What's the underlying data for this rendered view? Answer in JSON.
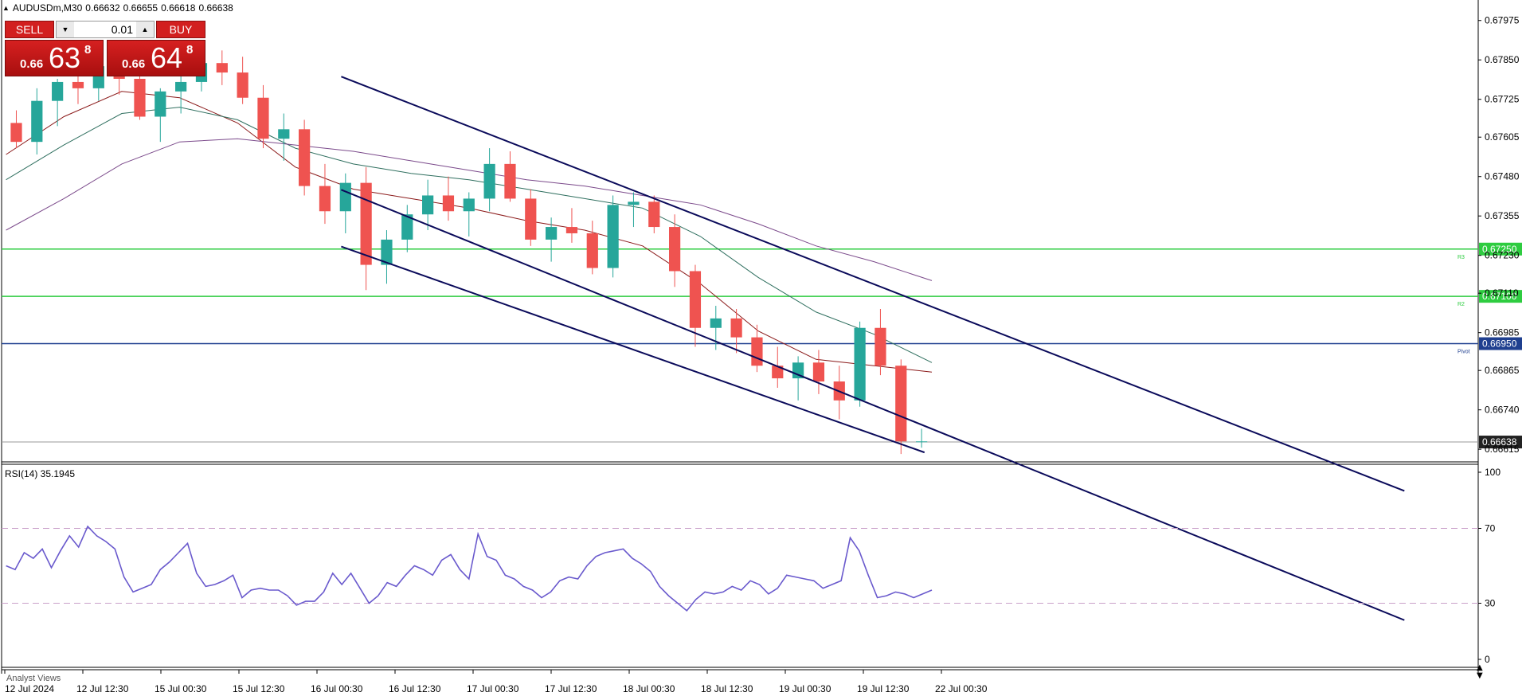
{
  "symbol_bar": {
    "symbol": "AUDUSDm,M30",
    "open": "0.66632",
    "high": "0.66655",
    "low": "0.66618",
    "close": "0.66638"
  },
  "trade_panel": {
    "sell_label": "SELL",
    "buy_label": "BUY",
    "lot": "0.01",
    "bid_prefix": "0.66",
    "bid_big": "63",
    "bid_sup": "8",
    "ask_prefix": "0.66",
    "ask_big": "64",
    "ask_sup": "8"
  },
  "colors": {
    "bull": "#26a69a",
    "bear": "#ef5350",
    "channel": "#0a0a5a",
    "level": "#2ecc40",
    "pivot": "#1f3f8f",
    "rsi": "#6a5acd",
    "ma_fast": "#8b1a1a",
    "ma_slow": "#2f6f5f",
    "ma_long": "#7b4a8b"
  },
  "analyst_views": "Analyst Views",
  "chart_data": [
    {
      "type": "candlestick",
      "title": "",
      "price_axis": {
        "ylim": [
          0.66575,
          0.6804
        ],
        "ticks": [
          "0.67975",
          "0.67850",
          "0.67725",
          "0.67605",
          "0.67480",
          "0.67355",
          "0.67230",
          "0.67110",
          "0.66985",
          "0.66865",
          "0.66740",
          "0.66615"
        ]
      },
      "time_axis": {
        "labels": [
          "12 Jul 2024",
          "12 Jul 12:30",
          "15 Jul 00:30",
          "15 Jul 12:30",
          "16 Jul 00:30",
          "16 Jul 12:30",
          "17 Jul 00:30",
          "17 Jul 12:30",
          "18 Jul 00:30",
          "18 Jul 12:30",
          "19 Jul 00:30",
          "19 Jul 12:30",
          "22 Jul 00:30"
        ]
      },
      "horizontal_levels": [
        {
          "name": "R3",
          "price": 0.6725,
          "label": "0.67250"
        },
        {
          "name": "R2",
          "price": 0.671,
          "label": "0.67100"
        },
        {
          "name": "Pivot",
          "price": 0.6695,
          "label": "0.66950"
        }
      ],
      "current_price": {
        "price": 0.66638,
        "label": "0.66638"
      },
      "channel_lines": [
        {
          "points": [
            [
              0.23,
              0.67797
            ],
            [
              0.95,
              0.66483
            ]
          ]
        },
        {
          "points": [
            [
              0.23,
              0.67438
            ],
            [
              0.95,
              0.66073
            ]
          ]
        },
        {
          "points": [
            [
              0.23,
              0.67258
            ],
            [
              0.625,
              0.66605
            ]
          ]
        }
      ],
      "ohlc": [
        [
          0.6765,
          0.6769,
          0.6757,
          0.6759
        ],
        [
          0.6759,
          0.6776,
          0.6755,
          0.6772
        ],
        [
          0.6772,
          0.6779,
          0.6764,
          0.6778
        ],
        [
          0.6778,
          0.6784,
          0.6771,
          0.6776
        ],
        [
          0.6776,
          0.6787,
          0.6772,
          0.6783
        ],
        [
          0.6783,
          0.6787,
          0.6774,
          0.6779
        ],
        [
          0.6779,
          0.6782,
          0.6766,
          0.6767
        ],
        [
          0.6767,
          0.6776,
          0.6759,
          0.6775
        ],
        [
          0.6775,
          0.6782,
          0.6768,
          0.6778
        ],
        [
          0.6778,
          0.6787,
          0.6775,
          0.6784
        ],
        [
          0.6784,
          0.6788,
          0.6777,
          0.6781
        ],
        [
          0.6781,
          0.6786,
          0.6771,
          0.6773
        ],
        [
          0.6773,
          0.6777,
          0.6757,
          0.676
        ],
        [
          0.676,
          0.6768,
          0.6753,
          0.6763
        ],
        [
          0.6763,
          0.6766,
          0.6742,
          0.6745
        ],
        [
          0.6745,
          0.6752,
          0.6733,
          0.6737
        ],
        [
          0.6737,
          0.6749,
          0.673,
          0.6746
        ],
        [
          0.6746,
          0.6751,
          0.6712,
          0.672
        ],
        [
          0.672,
          0.6731,
          0.6714,
          0.6728
        ],
        [
          0.6728,
          0.6739,
          0.6724,
          0.6736
        ],
        [
          0.6736,
          0.6747,
          0.6731,
          0.6742
        ],
        [
          0.6742,
          0.6748,
          0.6734,
          0.6737
        ],
        [
          0.6737,
          0.6743,
          0.6729,
          0.6741
        ],
        [
          0.6741,
          0.6757,
          0.6737,
          0.6752
        ],
        [
          0.6752,
          0.6756,
          0.674,
          0.6741
        ],
        [
          0.6741,
          0.6744,
          0.6726,
          0.6728
        ],
        [
          0.6728,
          0.6735,
          0.6721,
          0.6732
        ],
        [
          0.6732,
          0.6738,
          0.6727,
          0.673
        ],
        [
          0.673,
          0.6734,
          0.6717,
          0.6719
        ],
        [
          0.6719,
          0.6742,
          0.6716,
          0.6739
        ],
        [
          0.6739,
          0.6743,
          0.6732,
          0.674
        ],
        [
          0.674,
          0.6742,
          0.673,
          0.6732
        ],
        [
          0.6732,
          0.6736,
          0.6713,
          0.6718
        ],
        [
          0.6718,
          0.672,
          0.6694,
          0.67
        ],
        [
          0.67,
          0.6707,
          0.6693,
          0.6703
        ],
        [
          0.6703,
          0.6706,
          0.6692,
          0.6697
        ],
        [
          0.6697,
          0.6701,
          0.6686,
          0.6688
        ],
        [
          0.6688,
          0.6694,
          0.6681,
          0.6684
        ],
        [
          0.6684,
          0.6691,
          0.6677,
          0.6689
        ],
        [
          0.6689,
          0.6693,
          0.6679,
          0.6683
        ],
        [
          0.6683,
          0.6688,
          0.6671,
          0.6677
        ],
        [
          0.6677,
          0.6702,
          0.6675,
          0.67
        ],
        [
          0.67,
          0.6706,
          0.6685,
          0.6688
        ],
        [
          0.6688,
          0.669,
          0.666,
          0.6664
        ],
        [
          0.6664,
          0.6668,
          0.6662,
          0.6664
        ]
      ],
      "moving_averages": [
        {
          "values": [
            0.6755,
            0.6767,
            0.6775,
            0.6773,
            0.6765,
            0.6751,
            0.6744,
            0.6741,
            0.6738,
            0.6734,
            0.6731,
            0.6726,
            0.6714,
            0.6699,
            0.669,
            0.6688,
            0.6686
          ]
        },
        {
          "values": [
            0.6747,
            0.6758,
            0.6768,
            0.677,
            0.6766,
            0.6757,
            0.6752,
            0.6749,
            0.6747,
            0.6744,
            0.6741,
            0.6738,
            0.6729,
            0.6716,
            0.6705,
            0.6698,
            0.6689
          ]
        },
        {
          "values": [
            0.6731,
            0.6741,
            0.6752,
            0.6759,
            0.676,
            0.6758,
            0.6756,
            0.6753,
            0.675,
            0.6747,
            0.6745,
            0.6742,
            0.6739,
            0.6733,
            0.6726,
            0.6721,
            0.6715
          ]
        }
      ]
    },
    {
      "type": "line",
      "title": "RSI(14) 35.1945",
      "ylim": [
        0,
        100
      ],
      "yticks": [
        "100",
        "70",
        "30",
        "0"
      ],
      "reference_levels": [
        70,
        30
      ],
      "series": [
        {
          "values": [
            50,
            48,
            57,
            54,
            59,
            49,
            58,
            66,
            60,
            71,
            66,
            63,
            59,
            44,
            36,
            38,
            40,
            48,
            52,
            57,
            62,
            46,
            39,
            40,
            42,
            45,
            33,
            37,
            38,
            37,
            37,
            34,
            29,
            31,
            31,
            36,
            46,
            40,
            46,
            38,
            30,
            34,
            41,
            39,
            45,
            50,
            48,
            45,
            53,
            56,
            48,
            43,
            67,
            55,
            53,
            45,
            43,
            39,
            37,
            33,
            36,
            42,
            44,
            43,
            50,
            55,
            57,
            58,
            59,
            54,
            51,
            47,
            39,
            34,
            30,
            26,
            32,
            36,
            35,
            36,
            39,
            37,
            42,
            40,
            35,
            38,
            45,
            44,
            43,
            42,
            38,
            40,
            42,
            65,
            58,
            45,
            33,
            34,
            36,
            35,
            33,
            35,
            37
          ]
        }
      ]
    }
  ]
}
